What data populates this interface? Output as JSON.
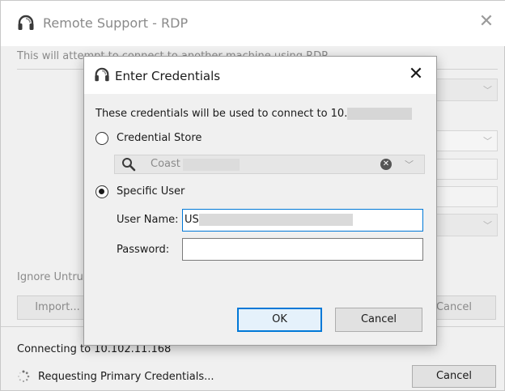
{
  "outer": {
    "title": "Remote Support - RDP",
    "description": "This will attempt to connect to another machine using RDP",
    "ignore_label": "Ignore Untru",
    "import_label": "Import...",
    "cancel_ghost_label": "Cancel",
    "connecting_text": "Connecting to 10.102.11.168",
    "status_text": "Requesting Primary Credentials...",
    "cancel_label": "Cancel",
    "close_glyph": "✕",
    "chevron_glyph": "﹀"
  },
  "dialog": {
    "title": "Enter Credentials",
    "close_glyph": "✕",
    "message": "These credentials will be used to connect to 10.",
    "credential_store": {
      "label": "Credential Store",
      "selected": false,
      "search_value": "Coast",
      "clear_glyph": "✕",
      "chevron_glyph": "﹀"
    },
    "specific_user": {
      "label": "Specific User",
      "selected": true
    },
    "username_label": "User Name:",
    "username_value": "US",
    "password_label": "Password:",
    "password_value": "",
    "ok_label": "OK",
    "cancel_label": "Cancel"
  },
  "icons": {
    "app": "headset-icon",
    "search": "search-icon",
    "spinner": "spinner-icon"
  },
  "colors": {
    "accent": "#0078d7",
    "window_bg": "#f0f0f0",
    "titlebar_bg": "#ffffff",
    "disabled_text": "#8a8a8a"
  }
}
